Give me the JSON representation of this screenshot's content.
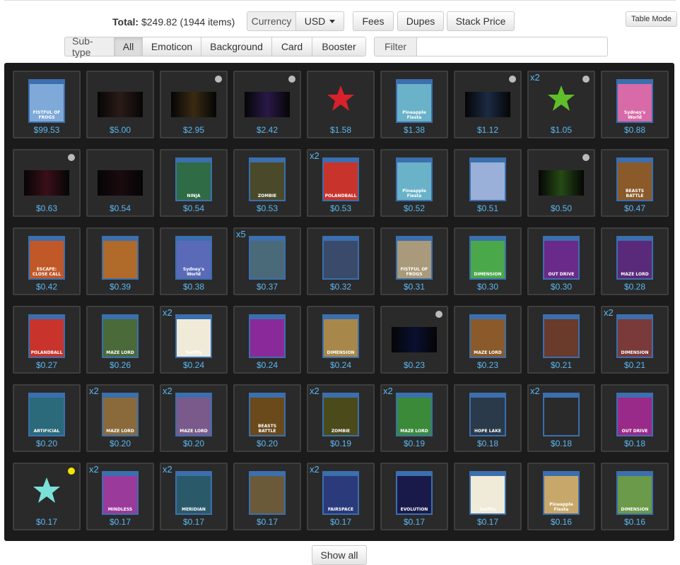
{
  "header": {
    "total_label": "Total:",
    "total_value": "$249.82 (1944 items)",
    "currency_label": "Currency",
    "currency_value": "USD",
    "fees": "Fees",
    "dupes": "Dupes",
    "stack_price": "Stack Price",
    "table_mode": "Table Mode"
  },
  "subtype": {
    "label": "Sub-type",
    "options": [
      "All",
      "Emoticon",
      "Background",
      "Card",
      "Booster"
    ],
    "active": "All"
  },
  "filter": {
    "label": "Filter",
    "value": ""
  },
  "show_all": "Show all",
  "colors": {
    "accent": "#5bb8f2",
    "panel": "#1b1b1b",
    "tile": "#2a2a2a"
  },
  "items": [
    {
      "price": "$99.53",
      "kind": "card",
      "art": "#7fa9d8",
      "label": "FISTFUL OF FROGS",
      "qty": "",
      "dot": ""
    },
    {
      "price": "$5.00",
      "kind": "background",
      "art": "#2b1b18",
      "label": "",
      "qty": "",
      "dot": ""
    },
    {
      "price": "$2.95",
      "kind": "background",
      "art": "#3a2a12",
      "label": "",
      "qty": "",
      "dot": "grey"
    },
    {
      "price": "$2.42",
      "kind": "background",
      "art": "#2a1848",
      "label": "",
      "qty": "",
      "dot": "grey"
    },
    {
      "price": "$1.58",
      "kind": "emoticon",
      "art": "#d8212a",
      "label": "",
      "qty": "",
      "dot": ""
    },
    {
      "price": "$1.38",
      "kind": "card",
      "art": "#6ab2c8",
      "label": "Pineapple Fiesta",
      "qty": "",
      "dot": ""
    },
    {
      "price": "$1.12",
      "kind": "background",
      "art": "#1c2a44",
      "label": "",
      "qty": "",
      "dot": "grey"
    },
    {
      "price": "$1.05",
      "kind": "emoticon",
      "art": "#5fbf2a",
      "label": "",
      "qty": "x2",
      "dot": "grey"
    },
    {
      "price": "$0.88",
      "kind": "card",
      "art": "#d86aa8",
      "label": "Sydney's World",
      "qty": "",
      "dot": ""
    },
    {
      "price": "$0.63",
      "kind": "background",
      "art": "#3a0f1a",
      "label": "",
      "qty": "",
      "dot": "grey"
    },
    {
      "price": "$0.54",
      "kind": "background",
      "art": "#1a0a0e",
      "label": "",
      "qty": "",
      "dot": ""
    },
    {
      "price": "$0.54",
      "kind": "card",
      "art": "#2f6b45",
      "label": "NINJA",
      "qty": "",
      "dot": ""
    },
    {
      "price": "$0.53",
      "kind": "card",
      "art": "#4a4a2a",
      "label": "ZOMBIE",
      "qty": "",
      "dot": ""
    },
    {
      "price": "$0.53",
      "kind": "card",
      "art": "#c8342c",
      "label": "POLANDBALL",
      "qty": "x2",
      "dot": ""
    },
    {
      "price": "$0.52",
      "kind": "card",
      "art": "#6ab2c8",
      "label": "Pineapple Fiesta",
      "qty": "",
      "dot": ""
    },
    {
      "price": "$0.51",
      "kind": "card",
      "art": "#9ab0d8",
      "label": "",
      "qty": "",
      "dot": ""
    },
    {
      "price": "$0.50",
      "kind": "background",
      "art": "#254a15",
      "label": "",
      "qty": "",
      "dot": "grey"
    },
    {
      "price": "$0.47",
      "kind": "card",
      "art": "#8a5a2a",
      "label": "BEASTS BATTLE",
      "qty": "",
      "dot": ""
    },
    {
      "price": "$0.42",
      "kind": "card",
      "art": "#c05828",
      "label": "ESCAPE: CLOSE CALL",
      "qty": "",
      "dot": ""
    },
    {
      "price": "$0.39",
      "kind": "card",
      "art": "#b06a2a",
      "label": "",
      "qty": "",
      "dot": ""
    },
    {
      "price": "$0.38",
      "kind": "card",
      "art": "#5a6ab8",
      "label": "Sydney's World",
      "qty": "",
      "dot": ""
    },
    {
      "price": "$0.37",
      "kind": "card",
      "art": "#4a6a7a",
      "label": "",
      "qty": "x5",
      "dot": ""
    },
    {
      "price": "$0.32",
      "kind": "card",
      "art": "#3a4a6a",
      "label": "",
      "qty": "",
      "dot": ""
    },
    {
      "price": "$0.31",
      "kind": "card",
      "art": "#a89a7a",
      "label": "FISTFUL OF FROGS",
      "qty": "",
      "dot": ""
    },
    {
      "price": "$0.30",
      "kind": "card",
      "art": "#4aa84a",
      "label": "DIMENSION",
      "qty": "",
      "dot": ""
    },
    {
      "price": "$0.30",
      "kind": "card",
      "art": "#6a2a8a",
      "label": "OUT DRIVE",
      "qty": "",
      "dot": ""
    },
    {
      "price": "$0.28",
      "kind": "card",
      "art": "#5a2a7a",
      "label": "MAZE LORD",
      "qty": "",
      "dot": ""
    },
    {
      "price": "$0.27",
      "kind": "card",
      "art": "#c8342c",
      "label": "POLANDBALL",
      "qty": "",
      "dot": ""
    },
    {
      "price": "$0.26",
      "kind": "card",
      "art": "#4a6a3a",
      "label": "MAZE LORD",
      "qty": "",
      "dot": ""
    },
    {
      "price": "$0.24",
      "kind": "card",
      "art": "#f0ead8",
      "label": "Swiftly",
      "qty": "x2",
      "dot": ""
    },
    {
      "price": "$0.24",
      "kind": "card",
      "art": "#8a2a9a",
      "label": "",
      "qty": "",
      "dot": ""
    },
    {
      "price": "$0.24",
      "kind": "card",
      "art": "#a8884a",
      "label": "DIMENSION",
      "qty": "",
      "dot": ""
    },
    {
      "price": "$0.23",
      "kind": "background",
      "art": "#0a1030",
      "label": "",
      "qty": "",
      "dot": "grey"
    },
    {
      "price": "$0.23",
      "kind": "card",
      "art": "#8a5a2a",
      "label": "MAZE LORD",
      "qty": "",
      "dot": ""
    },
    {
      "price": "$0.21",
      "kind": "card",
      "art": "#6a3a2a",
      "label": "",
      "qty": "",
      "dot": ""
    },
    {
      "price": "$0.21",
      "kind": "card",
      "art": "#7a3a3a",
      "label": "DIMENSION",
      "qty": "x2",
      "dot": ""
    },
    {
      "price": "$0.20",
      "kind": "card",
      "art": "#2a6a7a",
      "label": "ARTIFICIAL",
      "qty": "",
      "dot": ""
    },
    {
      "price": "$0.20",
      "kind": "card",
      "art": "#8a6a3a",
      "label": "MAZE LORD",
      "qty": "x2",
      "dot": ""
    },
    {
      "price": "$0.20",
      "kind": "card",
      "art": "#7a5a8a",
      "label": "MAZE LORD",
      "qty": "x2",
      "dot": ""
    },
    {
      "price": "$0.20",
      "kind": "card",
      "art": "#6a4a1a",
      "label": "BEASTS BATTLE",
      "qty": "",
      "dot": ""
    },
    {
      "price": "$0.19",
      "kind": "card",
      "art": "#4a4a1a",
      "label": "ZOMBIE",
      "qty": "x2",
      "dot": ""
    },
    {
      "price": "$0.19",
      "kind": "card",
      "art": "#3a8a3a",
      "label": "MAZE LORD",
      "qty": "x2",
      "dot": ""
    },
    {
      "price": "$0.18",
      "kind": "card",
      "art": "#2a3a4a",
      "label": "HOPE LAKE",
      "qty": "",
      "dot": ""
    },
    {
      "price": "$0.18",
      "kind": "card",
      "art": "#2a2a2a",
      "label": "",
      "qty": "x2",
      "dot": ""
    },
    {
      "price": "$0.18",
      "kind": "card",
      "art": "#9a2a8a",
      "label": "OUT DRIVE",
      "qty": "",
      "dot": ""
    },
    {
      "price": "$0.17",
      "kind": "emoticon",
      "art": "#7ae0d8",
      "label": "",
      "qty": "",
      "dot": "yellow"
    },
    {
      "price": "$0.17",
      "kind": "card",
      "art": "#9a3a9a",
      "label": "MINDLESS",
      "qty": "x2",
      "dot": ""
    },
    {
      "price": "$0.17",
      "kind": "card",
      "art": "#2a5a6a",
      "label": "MERIDIAN",
      "qty": "x2",
      "dot": ""
    },
    {
      "price": "$0.17",
      "kind": "card",
      "art": "#6a5a3a",
      "label": "",
      "qty": "",
      "dot": ""
    },
    {
      "price": "$0.17",
      "kind": "card",
      "art": "#2a3a7a",
      "label": "FAIRSPACE",
      "qty": "x2",
      "dot": ""
    },
    {
      "price": "$0.17",
      "kind": "card",
      "art": "#1a1a4a",
      "label": "EVOLUTION",
      "qty": "",
      "dot": ""
    },
    {
      "price": "$0.17",
      "kind": "card",
      "art": "#f0ead8",
      "label": "Swiftly",
      "qty": "",
      "dot": ""
    },
    {
      "price": "$0.16",
      "kind": "card",
      "art": "#c8a86a",
      "label": "Pineapple Fiesta",
      "qty": "",
      "dot": ""
    },
    {
      "price": "$0.16",
      "kind": "card",
      "art": "#6a9a4a",
      "label": "DIMENSION",
      "qty": "",
      "dot": ""
    }
  ]
}
